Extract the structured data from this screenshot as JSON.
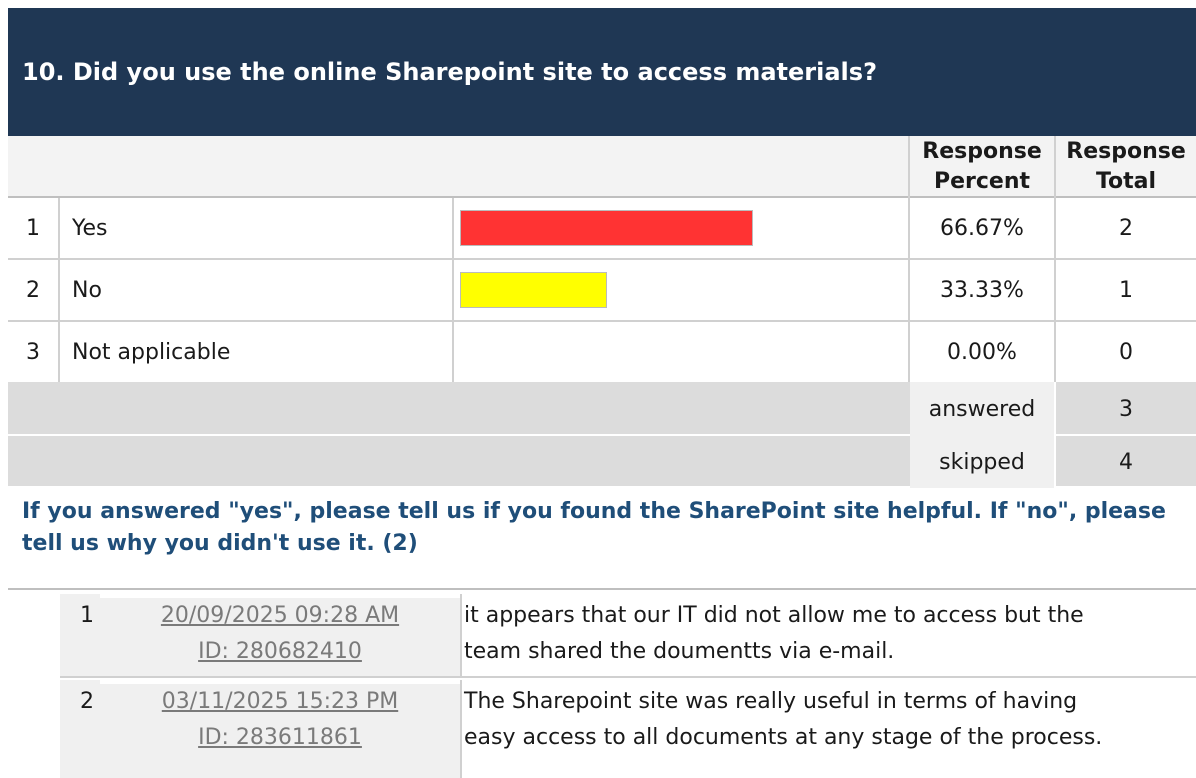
{
  "question": {
    "title": "10. Did you use the online Sharepoint site to access materials?"
  },
  "header": {
    "percent_line1": "Response",
    "percent_line2": "Percent",
    "total_line1": "Response",
    "total_line2": "Total"
  },
  "rows": [
    {
      "num": "1",
      "label": "Yes",
      "percent": "66.67%",
      "total": "2",
      "fraction": 0.6667,
      "color": "#ff3333"
    },
    {
      "num": "2",
      "label": "No",
      "percent": "33.33%",
      "total": "1",
      "fraction": 0.3333,
      "color": "#ffff00"
    },
    {
      "num": "3",
      "label": "Not applicable",
      "percent": "0.00%",
      "total": "0",
      "fraction": 0.0,
      "color": "#ffffff"
    }
  ],
  "summary": {
    "answered_label": "answered",
    "answered_value": "3",
    "skipped_label": "skipped",
    "skipped_value": "4"
  },
  "open_question": {
    "text": "If you answered \"yes\", please tell us if you found the SharePoint site helpful. If \"no\", please tell us why you didn't use it. (2)"
  },
  "responses": [
    {
      "num": "1",
      "date": "20/09/2025 09:28 AM",
      "id": "ID: 280682410",
      "line1": "it appears that our IT did not allow me to access but the",
      "line2": "team shared the doumentts via e-mail."
    },
    {
      "num": "2",
      "date": "03/11/2025 15:23 PM",
      "id": "ID: 283611861",
      "line1": "The Sharepoint site was really useful in terms of having",
      "line2": "easy access to all documents at any stage of the process."
    }
  ]
}
